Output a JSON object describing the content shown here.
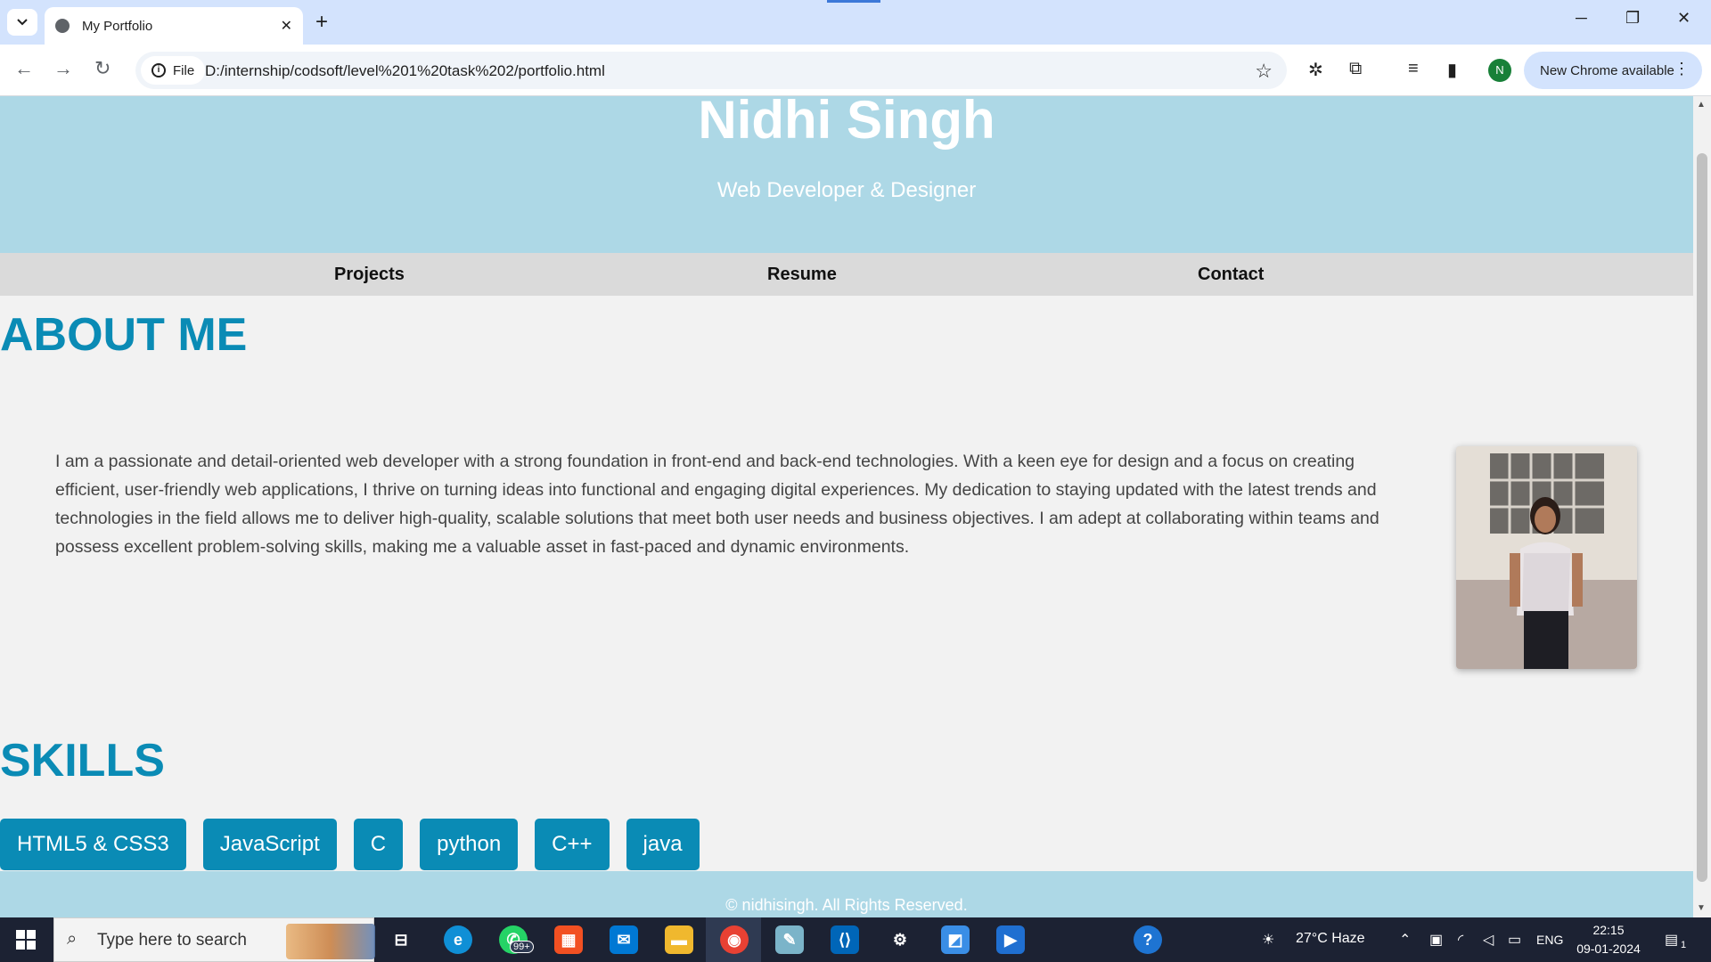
{
  "browser": {
    "tab_title": "My Portfolio",
    "tab_close": "✕",
    "new_tab": "+",
    "site_chip": "File",
    "url": "D:/internship/codsoft/level%201%20task%202/portfolio.html",
    "profile_initial": "N",
    "update_label": "New Chrome available",
    "window_minimize": "─",
    "window_restore": "❐",
    "window_close": "✕"
  },
  "page": {
    "name": "Nidhi Singh",
    "role": "Web Developer & Designer",
    "nav": [
      "Projects",
      "Resume",
      "Contact"
    ],
    "about_heading": "ABOUT ME",
    "about_text": "I am a passionate and detail-oriented web developer with a strong foundation in front-end and back-end technologies. With a keen eye for design and a focus on creating efficient, user-friendly web applications, I thrive on turning ideas into functional and engaging digital experiences. My dedication to staying updated with the latest trends and technologies in the field allows me to deliver high-quality, scalable solutions that meet both user needs and business objectives. I am adept at collaborating within teams and possess excellent problem-solving skills, making me a valuable asset in fast-paced and dynamic environments.",
    "skills_heading": "SKILLS",
    "skills": [
      "HTML5 & CSS3",
      "JavaScript",
      "C",
      "python",
      "C++",
      "java"
    ],
    "footer": "© nidhisingh. All Rights Reserved."
  },
  "taskbar": {
    "search_placeholder": "Type here to search",
    "whatsapp_badge": "99+",
    "weather": "27°C  Haze",
    "language": "ENG",
    "time": "22:15",
    "date": "09-01-2024",
    "notification_count": "1"
  },
  "colors": {
    "header_bg": "#add8e6",
    "accent": "#0a8bb5",
    "nav_bg": "#dadada"
  }
}
